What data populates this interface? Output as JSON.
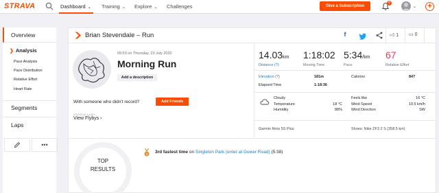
{
  "topnav": {
    "logo": "STRAVA",
    "dashboard": "Dashboard",
    "training": "Training",
    "explore": "Explore",
    "challenges": "Challenges",
    "subscribe": "Give a Subscription",
    "notifications_count": "8"
  },
  "sidebar": {
    "overview": "Overview",
    "analysis": "Analysis",
    "sub_items": [
      "Pace Analysis",
      "Pace Distribution",
      "Relative Effort",
      "Heart Rate"
    ],
    "segments": "Segments",
    "laps": "Laps",
    "more": "•••"
  },
  "header": {
    "title": "Brian Stevendale – Run",
    "kudos_count": "1",
    "comment_count": "0"
  },
  "activity": {
    "datetime": "09:53 on Thursday, 23 July 2020",
    "name": "Morning Run",
    "add_description": "Add a description",
    "with_someone": "With someone who didn't record?",
    "add_friends": "Add Friends",
    "labs": "STRAVA LABS",
    "flyby": "View Flybys ›"
  },
  "stats": {
    "distance_val": "14.03",
    "distance_unit": "km",
    "distance_lbl": "Distance (?)",
    "moving_val": "1:18:02",
    "moving_lbl": "Moving Time",
    "pace_val": "5:34",
    "pace_unit": "/km",
    "pace_lbl": "Pace",
    "effort_val": "67",
    "effort_lbl": "Relative Effort",
    "elevation_lbl": "Elevation (?)",
    "elevation_val": "181m",
    "calories_lbl": "Calories",
    "calories_val": "847",
    "elapsed_lbl": "Elapsed Time",
    "elapsed_val": "1:18:36"
  },
  "weather": {
    "condition": "Cloudy",
    "temperature_lbl": "Temperature",
    "temperature_val": "18 °C",
    "humidity_lbl": "Humidity",
    "humidity_val": "88%",
    "feels_lbl": "Feels like",
    "feels_val": "16 °C",
    "wind_speed_lbl": "Wind Speed",
    "wind_speed_val": "19.5 km/h",
    "wind_dir_lbl": "Wind Direction",
    "wind_dir_val": "SW"
  },
  "gear": {
    "device": "Garmin fēnix 5S Plus",
    "shoes": "Shoes: Nike ZF3 2 S (358.5 km)"
  },
  "results": {
    "label_line1": "TOP",
    "label_line2": "RESULTS",
    "achievement_bold": "3rd fastest time",
    "achievement_on": " on ",
    "achievement_segment": "Singleton Park (enter at Gower Road)",
    "achievement_time": " (5:38)"
  },
  "colors": {
    "brand": "#fc4c02",
    "link": "#1e7bc7",
    "effort": "#e83b54"
  }
}
